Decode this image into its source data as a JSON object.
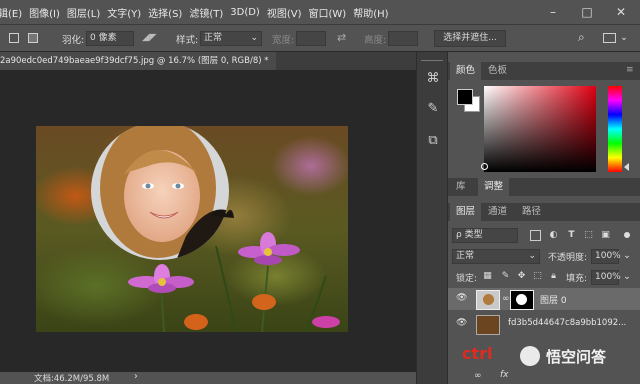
{
  "menu": {
    "items": [
      "辑(E)",
      "图像(I)",
      "图层(L)",
      "文字(Y)",
      "选择(S)",
      "滤镜(T)",
      "3D(D)",
      "视图(V)",
      "窗口(W)",
      "帮助(H)"
    ],
    "minimize": "–",
    "maximize": "□",
    "close": "✕"
  },
  "options": {
    "feather_label": "羽化:",
    "feather_value": "0 像素",
    "style_label": "样式:",
    "style_value": "正常",
    "width_label": "宽度:",
    "height_label": "高度:",
    "select_mask_button": "选择并遮住...",
    "search_icon": "search-icon",
    "panel_icon": "panel-layout-icon"
  },
  "document": {
    "tab_title": "2a90edc0ed749baeae9f39dcf75.jpg @ 16.7% (图层 0, RGB/8) *",
    "tab_close": "×"
  },
  "status": {
    "doc_info": "文档:46.2M/95.8M",
    "arrow": "›"
  },
  "color_panel": {
    "tabs": [
      "颜色",
      "色板"
    ],
    "foreground_color": "#000000",
    "background_color": "#ffffff"
  },
  "library_panel": {
    "tabs": [
      "库",
      "调整"
    ]
  },
  "layers_panel": {
    "tabs": [
      "图层",
      "通道",
      "路径"
    ],
    "filter_label": "ρ 类型",
    "blend_mode": "正常",
    "opacity_label": "不透明度:",
    "opacity_value": "100%",
    "lock_label": "锁定:",
    "fill_label": "填充:",
    "fill_value": "100%",
    "layers": [
      {
        "name": "图层 0",
        "selected": true
      },
      {
        "name": "fd3b5d44647c8a9bb1092...",
        "selected": false
      }
    ],
    "footer_fx": "fx"
  },
  "watermark": {
    "ctrl": "ctrl",
    "text": "悟空问答"
  }
}
